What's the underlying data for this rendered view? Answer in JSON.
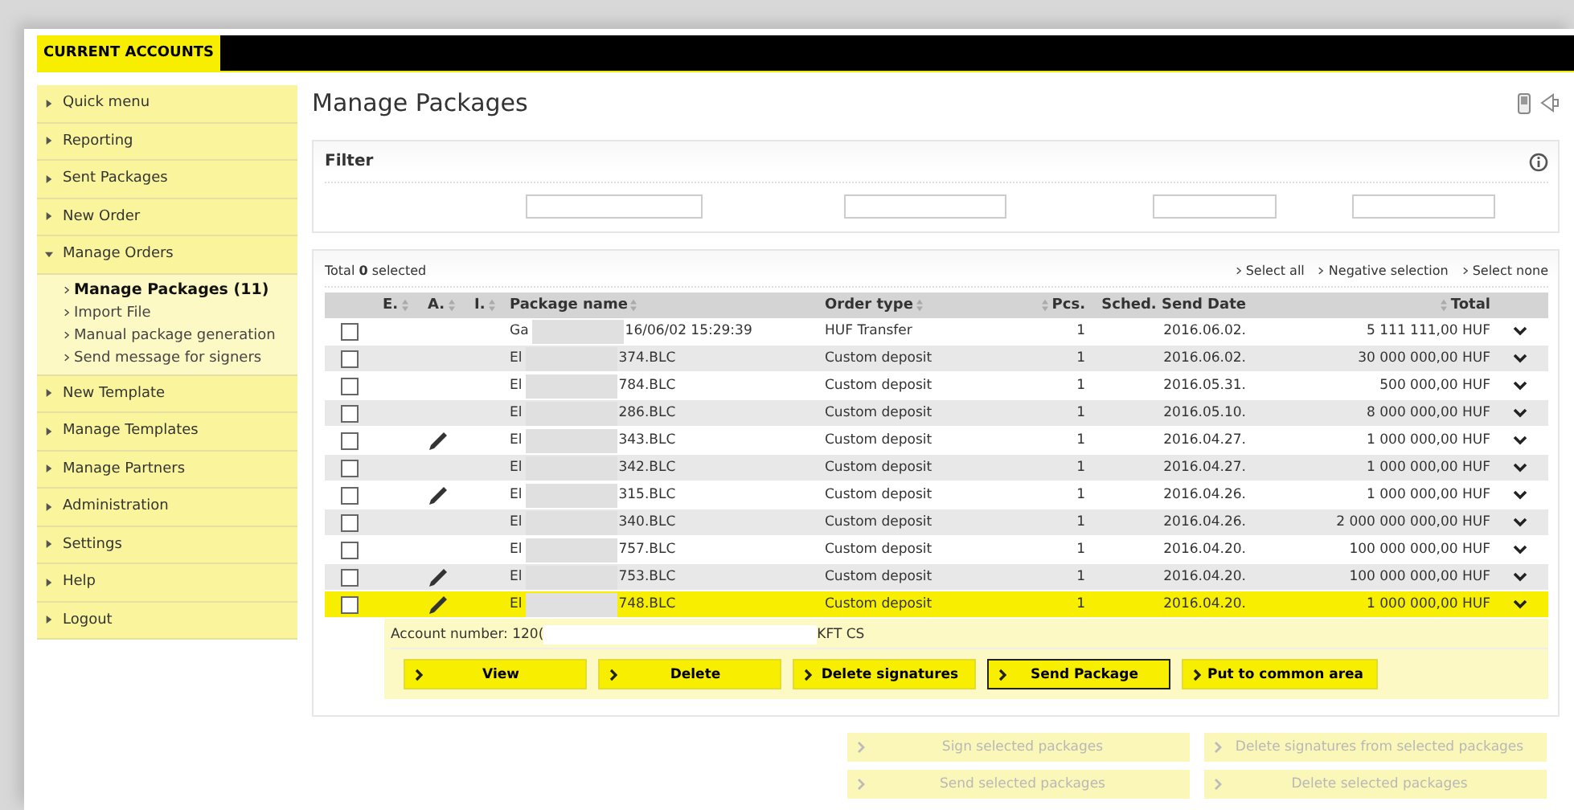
{
  "header": {
    "title": "CURRENT ACCOUNTS"
  },
  "sidebar": {
    "items": [
      {
        "label": "Quick menu",
        "expanded": false
      },
      {
        "label": "Reporting",
        "expanded": false
      },
      {
        "label": "Sent Packages",
        "expanded": false
      },
      {
        "label": "New Order",
        "expanded": false
      },
      {
        "label": "Manage Orders",
        "expanded": true,
        "children": [
          {
            "label": "Manage Packages (11)",
            "selected": true
          },
          {
            "label": "Import File",
            "selected": false
          },
          {
            "label": "Manual package generation",
            "selected": false
          },
          {
            "label": "Send message for signers",
            "selected": false
          }
        ]
      },
      {
        "label": "New Template",
        "expanded": false
      },
      {
        "label": "Manage Templates",
        "expanded": false
      },
      {
        "label": "Manage Partners",
        "expanded": false
      },
      {
        "label": "Administration",
        "expanded": false
      },
      {
        "label": "Settings",
        "expanded": false
      },
      {
        "label": "Help",
        "expanded": false
      },
      {
        "label": "Logout",
        "expanded": false
      }
    ]
  },
  "page_title": "Manage Packages",
  "filter": {
    "title": "Filter",
    "fields": [
      {
        "kind": "text"
      },
      {
        "kind": "text"
      },
      {
        "kind": "text"
      },
      {
        "kind": "text"
      }
    ]
  },
  "selection": {
    "summary": "Total **0** selected",
    "links": [
      "Select all",
      "Negative selection",
      "Select none"
    ]
  },
  "table": {
    "columns": [
      "E.",
      "A.",
      "I.",
      "Package name",
      "Order type",
      "Pcs.",
      "Sched. Send Date",
      "Total"
    ],
    "rows": [
      {
        "checked": false,
        "pencil": false,
        "name_start": "Ga",
        "name_end": "16/06/02 15:29:39",
        "order_type": "HUF Transfer",
        "pcs": "1",
        "date": "2016.06.02.",
        "total": "5 111 111,00 HUF",
        "selected": false
      },
      {
        "checked": false,
        "pencil": false,
        "name_start": "El",
        "name_end": "374.BLC",
        "order_type": "Custom deposit",
        "pcs": "1",
        "date": "2016.06.02.",
        "total": "30 000 000,00 HUF",
        "selected": false
      },
      {
        "checked": false,
        "pencil": false,
        "name_start": "El",
        "name_end": "784.BLC",
        "order_type": "Custom deposit",
        "pcs": "1",
        "date": "2016.05.31.",
        "total": "500 000,00 HUF",
        "selected": false
      },
      {
        "checked": false,
        "pencil": false,
        "name_start": "El",
        "name_end": "286.BLC",
        "order_type": "Custom deposit",
        "pcs": "1",
        "date": "2016.05.10.",
        "total": "8 000 000,00 HUF",
        "selected": false
      },
      {
        "checked": false,
        "pencil": true,
        "name_start": "El",
        "name_end": "343.BLC",
        "order_type": "Custom deposit",
        "pcs": "1",
        "date": "2016.04.27.",
        "total": "1 000 000,00 HUF",
        "selected": false
      },
      {
        "checked": false,
        "pencil": false,
        "name_start": "El",
        "name_end": "342.BLC",
        "order_type": "Custom deposit",
        "pcs": "1",
        "date": "2016.04.27.",
        "total": "1 000 000,00 HUF",
        "selected": false
      },
      {
        "checked": false,
        "pencil": true,
        "name_start": "El",
        "name_end": "315.BLC",
        "order_type": "Custom deposit",
        "pcs": "1",
        "date": "2016.04.26.",
        "total": "1 000 000,00 HUF",
        "selected": false
      },
      {
        "checked": false,
        "pencil": false,
        "name_start": "El",
        "name_end": "340.BLC",
        "order_type": "Custom deposit",
        "pcs": "1",
        "date": "2016.04.26.",
        "total": "2 000 000 000,00 HUF",
        "selected": false
      },
      {
        "checked": false,
        "pencil": false,
        "name_start": "El",
        "name_end": "757.BLC",
        "order_type": "Custom deposit",
        "pcs": "1",
        "date": "2016.04.20.",
        "total": "100 000 000,00 HUF",
        "selected": false
      },
      {
        "checked": false,
        "pencil": true,
        "name_start": "El",
        "name_end": "753.BLC",
        "order_type": "Custom deposit",
        "pcs": "1",
        "date": "2016.04.20.",
        "total": "100 000 000,00 HUF",
        "selected": false
      },
      {
        "checked": false,
        "pencil": true,
        "name_start": "El",
        "name_end": "748.BLC",
        "order_type": "Custom deposit",
        "pcs": "1",
        "date": "2016.04.20.",
        "total": "1 000 000,00 HUF",
        "selected": true
      }
    ]
  },
  "detail": {
    "account_start": "Account number: 120(",
    "account_end": "KFT CS",
    "buttons": [
      {
        "label": "View",
        "focused": false
      },
      {
        "label": "Delete",
        "focused": false
      },
      {
        "label": "Delete signatures",
        "focused": false
      },
      {
        "label": "Send Package",
        "focused": true
      },
      {
        "label": "Put to common area",
        "focused": false
      }
    ]
  },
  "bulk_buttons": [
    {
      "label": "Sign selected packages",
      "disabled": true
    },
    {
      "label": "Delete signatures from selected packages",
      "disabled": true
    },
    {
      "label": "Send selected packages",
      "disabled": true
    },
    {
      "label": "Delete selected packages",
      "disabled": true
    }
  ]
}
